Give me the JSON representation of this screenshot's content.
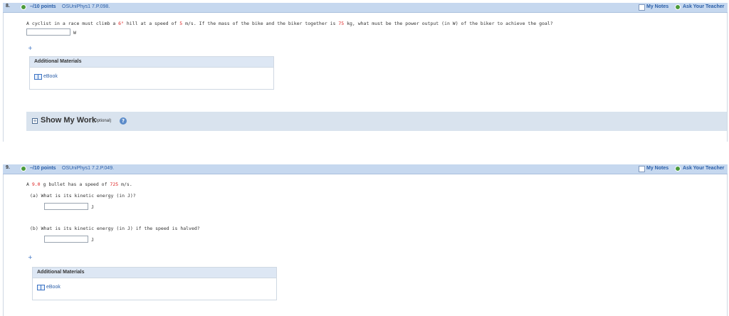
{
  "questions": [
    {
      "number": "8.",
      "points": "–/10 points",
      "ref": "OSUniPhys1 7.P.098.",
      "my_notes": "My Notes",
      "ask_teacher": "Ask Your Teacher",
      "text_parts": [
        "A cyclist in a race must climb a ",
        "6°",
        " hill at a speed of ",
        "5",
        " m/s. If the mass of the bike and the biker together is ",
        "75",
        " kg, what must be the power output (in W) of the biker to achieve the goal?"
      ],
      "answer_unit": "W",
      "plus": "+",
      "additional_materials": "Additional Materials",
      "ebook": "eBook",
      "show_my_work": "Show My Work",
      "optional": "(Optional)",
      "help": "?"
    },
    {
      "number": "9.",
      "points": "–/10 points",
      "ref": "OSUniPhys1 7.2.P.049.",
      "my_notes": "My Notes",
      "ask_teacher": "Ask Your Teacher",
      "text_parts": [
        "A ",
        "9.0",
        " g bullet has a speed of ",
        "725",
        " m/s."
      ],
      "part_a": "(a)  What is its kinetic energy (in J)?",
      "part_a_unit": "J",
      "part_b": "(b)  What is its kinetic energy (in J) if the speed is halved?",
      "part_b_unit": "J",
      "plus": "+",
      "additional_materials": "Additional Materials",
      "ebook": "eBook"
    }
  ],
  "colors": {
    "header_bg": "#c6d8ef",
    "link_blue": "#2a5ea8",
    "value_red": "#dd2222",
    "status_green": "#4a9a3a"
  }
}
